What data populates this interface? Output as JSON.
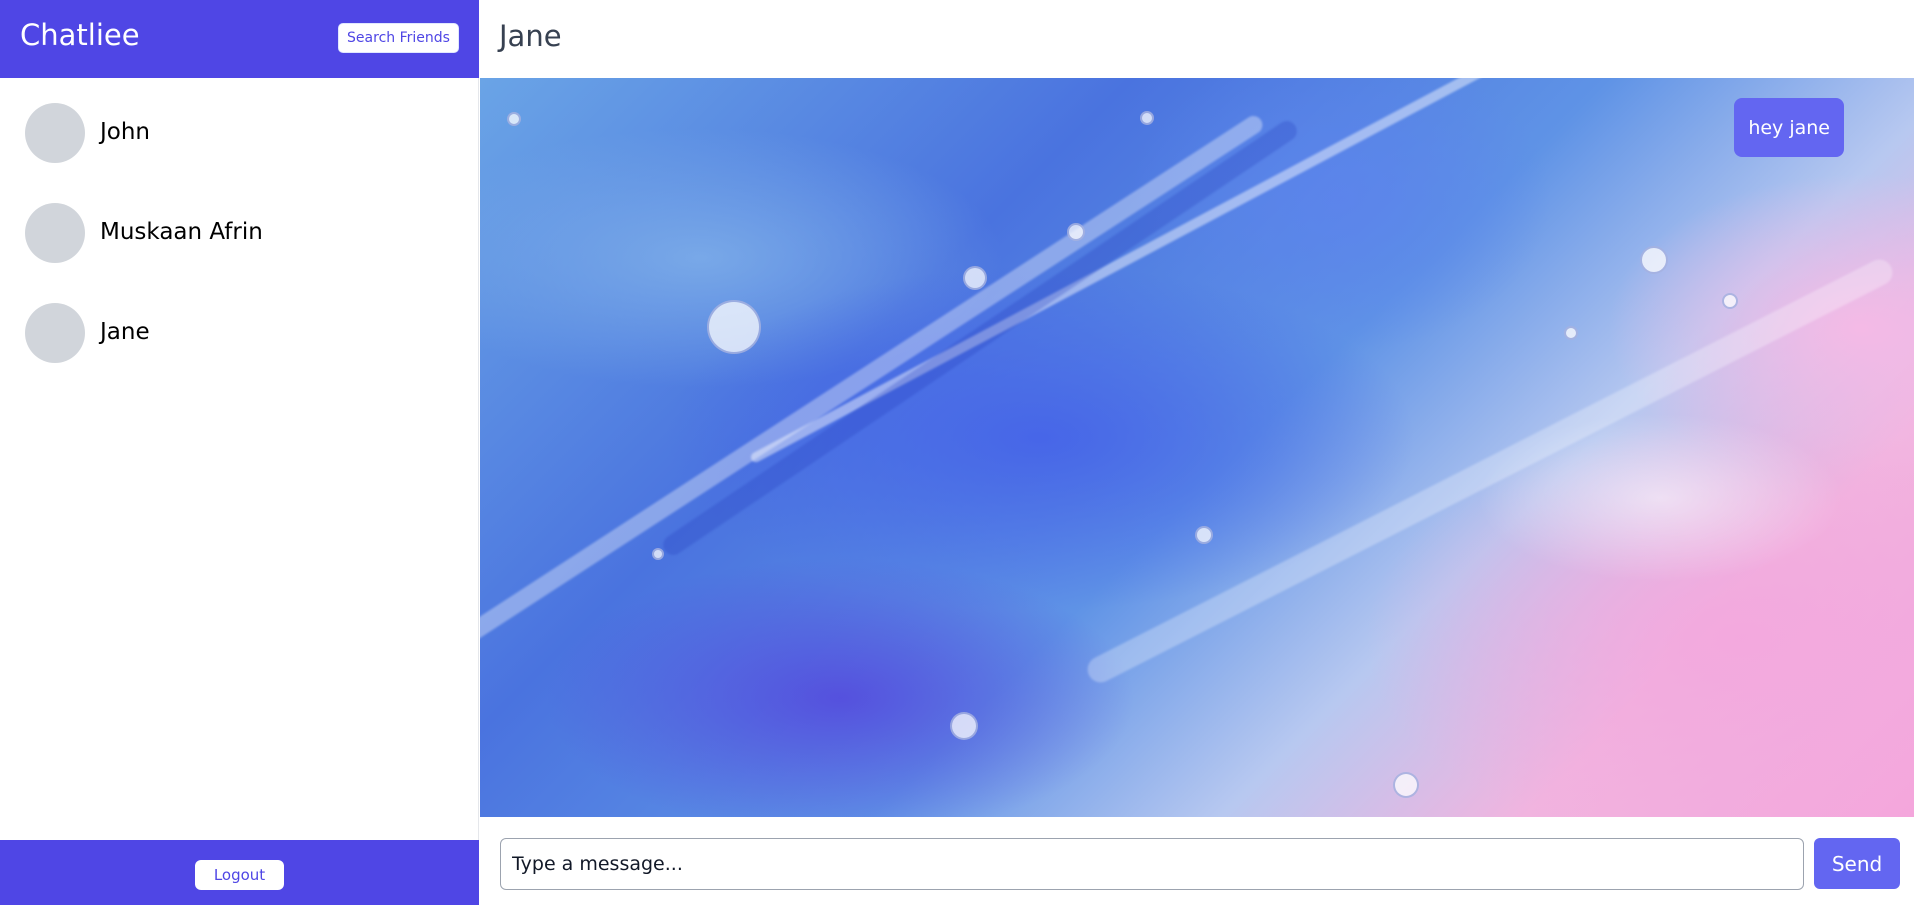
{
  "app": {
    "title": "Chatliee"
  },
  "sidebar": {
    "search_button": "Search Friends",
    "contacts": [
      {
        "name": "John"
      },
      {
        "name": "Muskaan Afrin"
      },
      {
        "name": "Jane"
      }
    ],
    "logout_button": "Logout"
  },
  "chat": {
    "title": "Jane",
    "messages": [
      {
        "text": "hey jane",
        "direction": "sent"
      }
    ],
    "input": {
      "placeholder": "Type a message..."
    },
    "send_button": "Send"
  },
  "colors": {
    "brand": "#4f46e5",
    "accent": "#6366f1",
    "avatar": "#d1d5db"
  }
}
